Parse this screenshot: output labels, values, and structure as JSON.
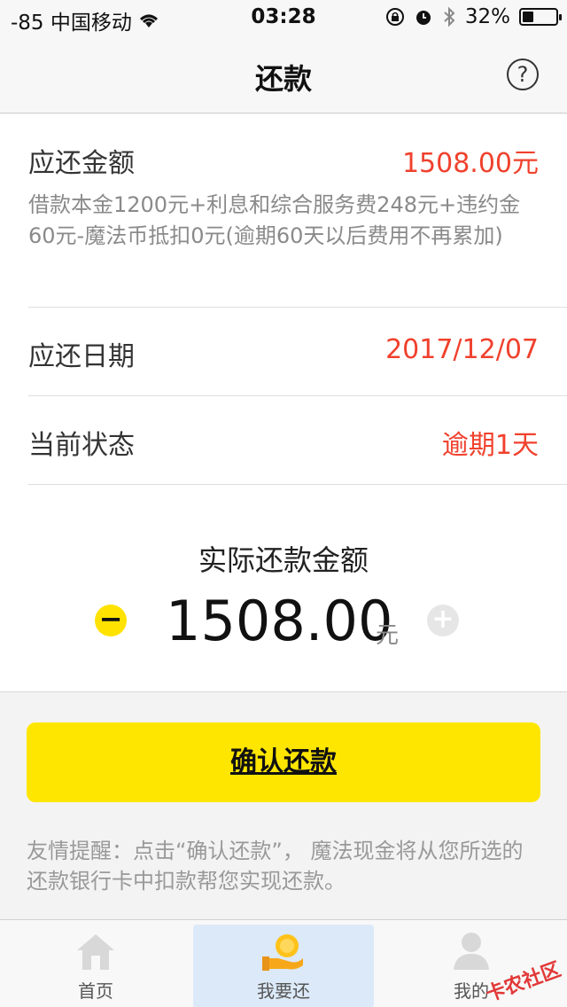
{
  "status_bar": {
    "carrier": "-85 中国移动",
    "time": "03:28",
    "battery": "32%",
    "battery_level": 0.32
  },
  "nav": {
    "title": "还款",
    "help_icon": "question-circle-icon"
  },
  "due": {
    "label": "应还金额",
    "value": "1508.00元",
    "desc": "借款本金1200元+利息和综合服务费248元+违约金60元-魔法币抵扣0元(逾期60天以后费用不再累加)"
  },
  "due_date": {
    "label": "应还日期",
    "value": "2017/12/07"
  },
  "status": {
    "label": "当前状态",
    "value": "逾期1天"
  },
  "actual": {
    "label": "实际还款金额",
    "amount": "1508.00",
    "unit": "元",
    "minus": "−",
    "plus": "+"
  },
  "confirm_label": "确认还款",
  "tip": "友情提醒：点击“确认还款”， 魔法现金将从您所选的还款银行卡中扣款帮您实现还款。",
  "tabs": [
    {
      "label": "首页",
      "icon": "home-icon"
    },
    {
      "label": "我要还",
      "icon": "coin-hand-icon"
    },
    {
      "label": "我的",
      "icon": "user-icon"
    }
  ],
  "watermark": "卡农社区",
  "colors": {
    "accent_yellow": "#ffe600",
    "value_red": "#f0412d"
  }
}
